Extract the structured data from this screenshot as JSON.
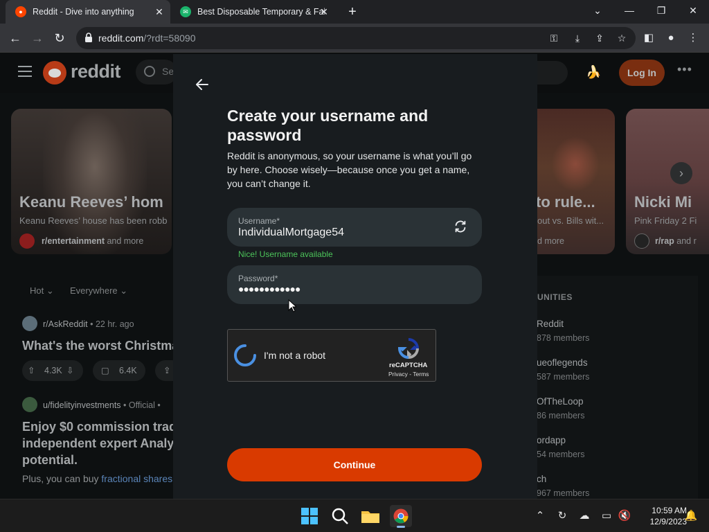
{
  "browser": {
    "tabs": [
      {
        "title": "Reddit - Dive into anything",
        "favicon": "reddit-icon",
        "active": true
      },
      {
        "title": "Best Disposable Temporary & Fal",
        "favicon": "tempmail-icon",
        "active": false
      }
    ],
    "url_host": "reddit.com",
    "url_path": "/?rdt=58090"
  },
  "reddit": {
    "brand": "reddit",
    "search_placeholder": "Se",
    "login_label": "Log In",
    "carousel": [
      {
        "headline": "Keanu Reeves’ hom",
        "sub": "Keanu Reeves’ house has been robb",
        "sub_name": "r/entertainment",
        "sub_more": " and more"
      },
      {
        "headline": "to rule...",
        "sub": "out vs. Bills wit...",
        "sub_name": "",
        "sub_more": "d more"
      },
      {
        "headline": "Nicki Mi",
        "sub": "Pink Friday 2 Fi",
        "sub_name": "r/rap",
        "sub_more": " and r"
      }
    ],
    "filters": {
      "sort": "Hot",
      "scope": "Everywhere"
    },
    "feed": [
      {
        "sub": "r/AskReddit",
        "time": "• 22 hr. ago",
        "title": "What's the worst Christma",
        "upvotes": "4.3K",
        "comments": "6.4K"
      },
      {
        "sub": "u/fidelityinvestments",
        "time": "• Official •",
        "title_lines": [
          "Enjoy $0 commission trade",
          "independent expert Analys",
          "potential."
        ],
        "text_prefix": "Plus, you can buy ",
        "text_link": "fractional shares"
      }
    ],
    "communities_title": "UNITIES",
    "communities": [
      {
        "name": "Reddit",
        "members": "878 members"
      },
      {
        "name": "ueoflegends",
        "members": "587 members"
      },
      {
        "name": "OfTheLoop",
        "members": "86 members"
      },
      {
        "name": "ordapp",
        "members": "54 members"
      },
      {
        "name": "ch",
        "members": "967 members"
      }
    ]
  },
  "modal": {
    "title": "Create your username and password",
    "description": "Reddit is anonymous, so your username is what you’ll go by here. Choose wisely—because once you get a name, you can’t change it.",
    "username_label": "Username*",
    "username_value": "IndividualMortgage54",
    "username_status": "Nice! Username available",
    "password_label": "Password*",
    "password_dots": "●●●●●●●●●●●●",
    "captcha_label": "I'm not a robot",
    "captcha_brand": "reCAPTCHA",
    "captcha_terms": "Privacy - Terms",
    "continue_label": "Continue"
  },
  "taskbar": {
    "time": "10:59 AM",
    "date": "12/9/2023"
  },
  "colors": {
    "accent": "#d93a00",
    "success": "#4cc45a",
    "modal_bg": "#181c1f",
    "field_bg": "#2a3236"
  }
}
